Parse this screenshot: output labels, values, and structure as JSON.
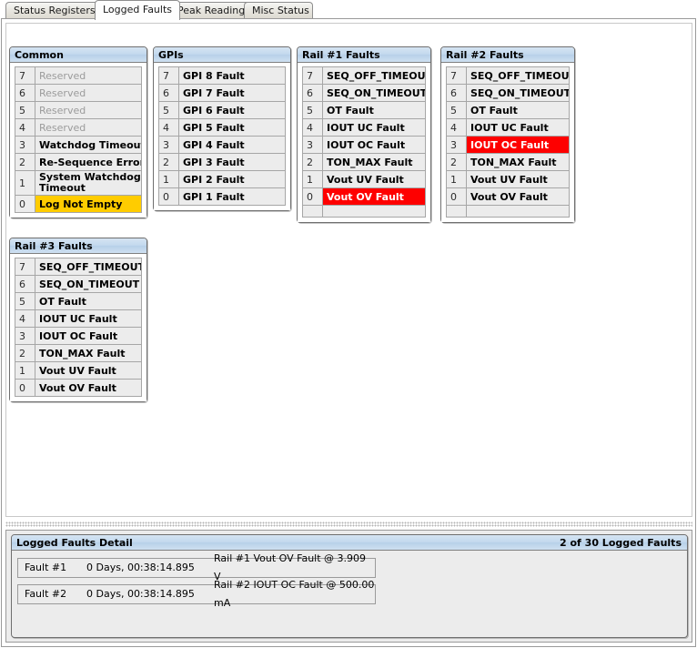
{
  "tabs": [
    {
      "label": "Status Registers",
      "selected": false
    },
    {
      "label": "Logged Faults",
      "selected": true
    },
    {
      "label": "Peak Readings",
      "selected": false
    },
    {
      "label": "Misc Status",
      "selected": false
    }
  ],
  "colors": {
    "header_gradient_top": "#d5e4f2",
    "header_gradient_bottom": "#cfe0f1",
    "row_background": "#ececec",
    "row_border": "#a6a6a6",
    "fault_highlight": "#fe0000",
    "fault_highlight_text": "#ffffff",
    "warn_highlight": "#ffcc00",
    "reserved_text": "#9b9b9b",
    "panel_border": "#6f6f6f"
  },
  "panels": [
    {
      "id": "common",
      "title": "Common",
      "has_trailing_spacer": false,
      "rows": [
        {
          "bit": "7",
          "label": "Reserved",
          "state": "reserved"
        },
        {
          "bit": "6",
          "label": "Reserved",
          "state": "reserved"
        },
        {
          "bit": "5",
          "label": "Reserved",
          "state": "reserved"
        },
        {
          "bit": "4",
          "label": "Reserved",
          "state": "reserved"
        },
        {
          "bit": "3",
          "label": "Watchdog Timeout",
          "state": "normal"
        },
        {
          "bit": "2",
          "label": "Re-Sequence Error",
          "state": "normal"
        },
        {
          "bit": "1",
          "label": "System Watchdog Timeout",
          "state": "normal",
          "twoline": true
        },
        {
          "bit": "0",
          "label": "Log Not Empty",
          "state": "warn"
        }
      ]
    },
    {
      "id": "gpis",
      "title": "GPIs",
      "has_trailing_spacer": false,
      "rows": [
        {
          "bit": "7",
          "label": "GPI 8 Fault",
          "state": "normal"
        },
        {
          "bit": "6",
          "label": "GPI 7 Fault",
          "state": "normal"
        },
        {
          "bit": "5",
          "label": "GPI 6 Fault",
          "state": "normal"
        },
        {
          "bit": "4",
          "label": "GPI 5 Fault",
          "state": "normal"
        },
        {
          "bit": "3",
          "label": "GPI 4 Fault",
          "state": "normal"
        },
        {
          "bit": "2",
          "label": "GPI 3 Fault",
          "state": "normal"
        },
        {
          "bit": "1",
          "label": "GPI 2 Fault",
          "state": "normal"
        },
        {
          "bit": "0",
          "label": "GPI 1 Fault",
          "state": "normal"
        }
      ]
    },
    {
      "id": "rail1",
      "title": "Rail #1 Faults",
      "has_trailing_spacer": true,
      "rows": [
        {
          "bit": "7",
          "label": "SEQ_OFF_TIMEOUT",
          "state": "normal"
        },
        {
          "bit": "6",
          "label": "SEQ_ON_TIMEOUT",
          "state": "normal"
        },
        {
          "bit": "5",
          "label": "OT Fault",
          "state": "normal"
        },
        {
          "bit": "4",
          "label": "IOUT UC Fault",
          "state": "normal"
        },
        {
          "bit": "3",
          "label": "IOUT OC Fault",
          "state": "normal"
        },
        {
          "bit": "2",
          "label": "TON_MAX Fault",
          "state": "normal"
        },
        {
          "bit": "1",
          "label": "Vout UV Fault",
          "state": "normal"
        },
        {
          "bit": "0",
          "label": "Vout OV Fault",
          "state": "fault"
        }
      ]
    },
    {
      "id": "rail2",
      "title": "Rail #2 Faults",
      "has_trailing_spacer": true,
      "rows": [
        {
          "bit": "7",
          "label": "SEQ_OFF_TIMEOUT",
          "state": "normal"
        },
        {
          "bit": "6",
          "label": "SEQ_ON_TIMEOUT",
          "state": "normal"
        },
        {
          "bit": "5",
          "label": "OT Fault",
          "state": "normal"
        },
        {
          "bit": "4",
          "label": "IOUT UC Fault",
          "state": "normal"
        },
        {
          "bit": "3",
          "label": "IOUT OC Fault",
          "state": "fault"
        },
        {
          "bit": "2",
          "label": "TON_MAX Fault",
          "state": "normal"
        },
        {
          "bit": "1",
          "label": "Vout UV Fault",
          "state": "normal"
        },
        {
          "bit": "0",
          "label": "Vout OV Fault",
          "state": "normal"
        }
      ]
    },
    {
      "id": "rail3",
      "title": "Rail #3 Faults",
      "has_trailing_spacer": false,
      "rows": [
        {
          "bit": "7",
          "label": "SEQ_OFF_TIMEOUT",
          "state": "normal"
        },
        {
          "bit": "6",
          "label": "SEQ_ON_TIMEOUT",
          "state": "normal"
        },
        {
          "bit": "5",
          "label": "OT Fault",
          "state": "normal"
        },
        {
          "bit": "4",
          "label": "IOUT UC Fault",
          "state": "normal"
        },
        {
          "bit": "3",
          "label": "IOUT OC Fault",
          "state": "normal"
        },
        {
          "bit": "2",
          "label": "TON_MAX Fault",
          "state": "normal"
        },
        {
          "bit": "1",
          "label": "Vout UV Fault",
          "state": "normal"
        },
        {
          "bit": "0",
          "label": "Vout OV Fault",
          "state": "normal"
        }
      ]
    }
  ],
  "detail": {
    "title": "Logged Faults Detail",
    "count_label": "2 of 30 Logged Faults",
    "rows": [
      {
        "id": "Fault #1",
        "time": "0 Days, 00:38:14.895",
        "description": "Rail #1 Vout OV Fault @ 3.909 V"
      },
      {
        "id": "Fault #2",
        "time": "0 Days, 00:38:14.895",
        "description": "Rail #2 IOUT OC Fault @ 500.00 mA"
      }
    ]
  }
}
